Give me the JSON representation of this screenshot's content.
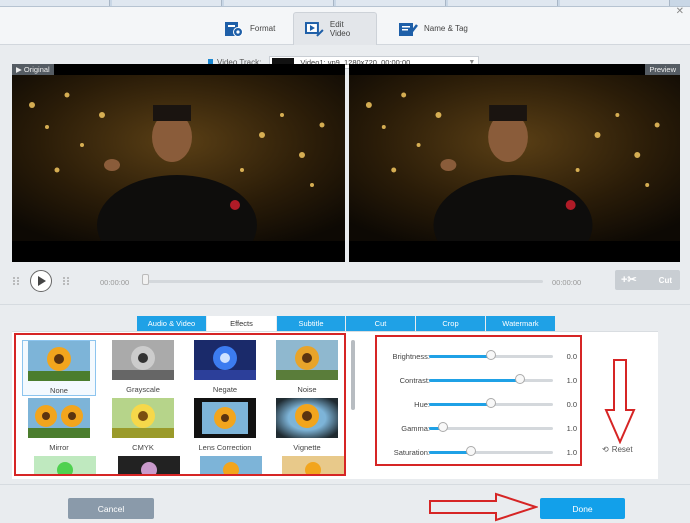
{
  "toolbar": {
    "tabs": [
      {
        "label": "Format",
        "icon": "format-icon"
      },
      {
        "label": "Edit Video",
        "icon": "edit-video-icon",
        "active": true
      },
      {
        "label": "Name & Tag",
        "icon": "name-tag-icon"
      }
    ]
  },
  "video_track": {
    "label": "Video Track:",
    "selected": "Video1: vp9, 1280x720, 00:00:00"
  },
  "preview": {
    "original_label": "Original",
    "preview_label": "Preview"
  },
  "transport": {
    "current_time": "00:00:00",
    "end_time": "00:00:00",
    "cut_label": "Cut",
    "position": 0.0
  },
  "edit_tabs": [
    {
      "label": "Audio & Video"
    },
    {
      "label": "Effects",
      "active": true
    },
    {
      "label": "Subtitle"
    },
    {
      "label": "Cut"
    },
    {
      "label": "Crop"
    },
    {
      "label": "Watermark"
    }
  ],
  "effects": [
    {
      "label": "None",
      "selected": true
    },
    {
      "label": "Grayscale"
    },
    {
      "label": "Negate"
    },
    {
      "label": "Noise"
    },
    {
      "label": "Mirror"
    },
    {
      "label": "CMYK"
    },
    {
      "label": "Lens Correction"
    },
    {
      "label": "Vignette"
    }
  ],
  "adjustments": [
    {
      "name": "Brightness:",
      "value": "0.0",
      "level": 0.5
    },
    {
      "name": "Contrast:",
      "value": "1.0",
      "level": 0.73
    },
    {
      "name": "Hue:",
      "value": "0.0",
      "level": 0.5
    },
    {
      "name": "Gamma:",
      "value": "1.0",
      "level": 0.11
    },
    {
      "name": "Saturation:",
      "value": "1.0",
      "level": 0.34
    }
  ],
  "reset_label": "Reset",
  "footer": {
    "cancel_label": "Cancel",
    "done_label": "Done"
  },
  "colors": {
    "accent": "#1fa1e6",
    "annotation_red": "#d62525"
  }
}
